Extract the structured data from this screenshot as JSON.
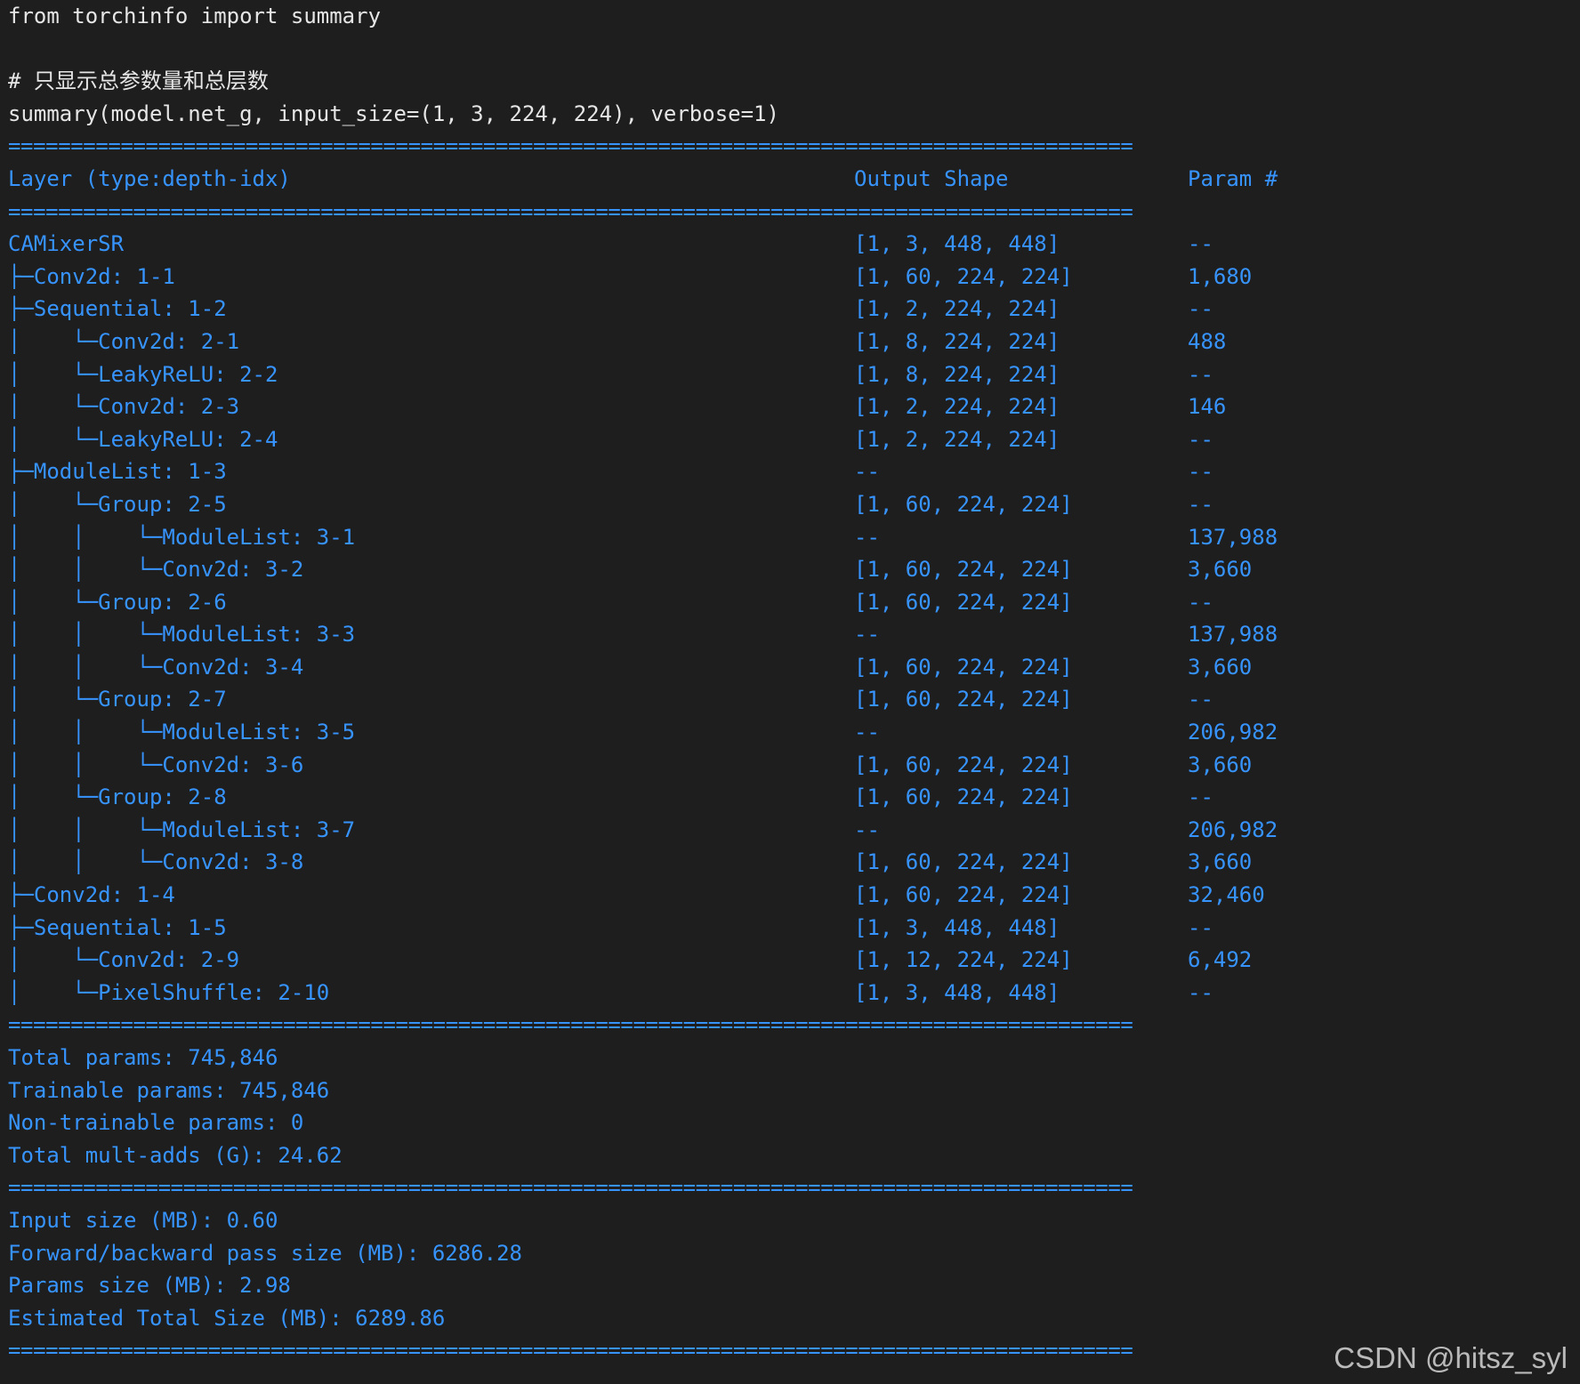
{
  "code": {
    "import_line": "from torchinfo import summary",
    "comment_line": "# 只显示总参数量和总层数",
    "call_line": "summary(model.net_g, input_size=(1, 3, 224, 224), verbose=1)"
  },
  "separator": "==========================================================================================",
  "header": {
    "layer": "Layer (type:depth-idx)",
    "shape": "Output Shape",
    "param": "Param #"
  },
  "rows": [
    {
      "layer": "CAMixerSR",
      "shape": "[1, 3, 448, 448]",
      "param": "--"
    },
    {
      "layer": "├─Conv2d: 1-1",
      "shape": "[1, 60, 224, 224]",
      "param": "1,680"
    },
    {
      "layer": "├─Sequential: 1-2",
      "shape": "[1, 2, 224, 224]",
      "param": "--"
    },
    {
      "layer": "│    └─Conv2d: 2-1",
      "shape": "[1, 8, 224, 224]",
      "param": "488"
    },
    {
      "layer": "│    └─LeakyReLU: 2-2",
      "shape": "[1, 8, 224, 224]",
      "param": "--"
    },
    {
      "layer": "│    └─Conv2d: 2-3",
      "shape": "[1, 2, 224, 224]",
      "param": "146"
    },
    {
      "layer": "│    └─LeakyReLU: 2-4",
      "shape": "[1, 2, 224, 224]",
      "param": "--"
    },
    {
      "layer": "├─ModuleList: 1-3",
      "shape": "--",
      "param": "--"
    },
    {
      "layer": "│    └─Group: 2-5",
      "shape": "[1, 60, 224, 224]",
      "param": "--"
    },
    {
      "layer": "│    │    └─ModuleList: 3-1",
      "shape": "--",
      "param": "137,988"
    },
    {
      "layer": "│    │    └─Conv2d: 3-2",
      "shape": "[1, 60, 224, 224]",
      "param": "3,660"
    },
    {
      "layer": "│    └─Group: 2-6",
      "shape": "[1, 60, 224, 224]",
      "param": "--"
    },
    {
      "layer": "│    │    └─ModuleList: 3-3",
      "shape": "--",
      "param": "137,988"
    },
    {
      "layer": "│    │    └─Conv2d: 3-4",
      "shape": "[1, 60, 224, 224]",
      "param": "3,660"
    },
    {
      "layer": "│    └─Group: 2-7",
      "shape": "[1, 60, 224, 224]",
      "param": "--"
    },
    {
      "layer": "│    │    └─ModuleList: 3-5",
      "shape": "--",
      "param": "206,982"
    },
    {
      "layer": "│    │    └─Conv2d: 3-6",
      "shape": "[1, 60, 224, 224]",
      "param": "3,660"
    },
    {
      "layer": "│    └─Group: 2-8",
      "shape": "[1, 60, 224, 224]",
      "param": "--"
    },
    {
      "layer": "│    │    └─ModuleList: 3-7",
      "shape": "--",
      "param": "206,982"
    },
    {
      "layer": "│    │    └─Conv2d: 3-8",
      "shape": "[1, 60, 224, 224]",
      "param": "3,660"
    },
    {
      "layer": "├─Conv2d: 1-4",
      "shape": "[1, 60, 224, 224]",
      "param": "32,460"
    },
    {
      "layer": "├─Sequential: 1-5",
      "shape": "[1, 3, 448, 448]",
      "param": "--"
    },
    {
      "layer": "│    └─Conv2d: 2-9",
      "shape": "[1, 12, 224, 224]",
      "param": "6,492"
    },
    {
      "layer": "│    └─PixelShuffle: 2-10",
      "shape": "[1, 3, 448, 448]",
      "param": "--"
    }
  ],
  "totals": {
    "total_params": "Total params: 745,846",
    "trainable_params": "Trainable params: 745,846",
    "non_trainable_params": "Non-trainable params: 0",
    "mult_adds": "Total mult-adds (G): 24.62"
  },
  "sizes": {
    "input_size": "Input size (MB): 0.60",
    "fwd_bwd_size": "Forward/backward pass size (MB): 6286.28",
    "params_size": "Params size (MB): 2.98",
    "total_size": "Estimated Total Size (MB): 6289.86"
  },
  "watermark": "CSDN @hitsz_syl",
  "colors": {
    "background": "#1e1e1e",
    "code_text": "#e6e6e6",
    "output_text": "#3794ff"
  }
}
